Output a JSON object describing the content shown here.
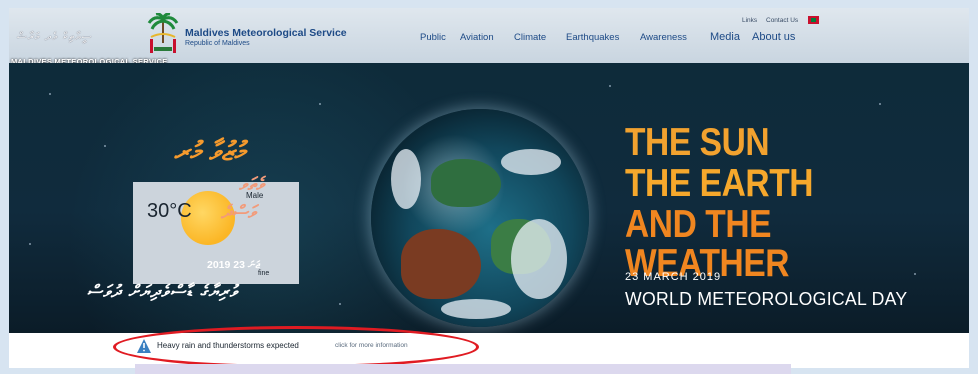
{
  "header": {
    "logo_dhivehi_text": "ސީޔާތިކް ވެދ މަރާޝް",
    "site_name": "Maldives Meteorological Service",
    "site_subtitle": "Republic of Maldives",
    "brand_strip": "MALDIVES METEOROLOGICAL SERVICE",
    "util_links": [
      "Links",
      "Contact Us"
    ],
    "nav": [
      "Public",
      "Aviation",
      "Climate",
      "Earthquakes",
      "Awareness",
      "Media",
      "About us"
    ]
  },
  "weather_widget": {
    "temperature": "30°C",
    "city": "Male",
    "condition": "fine",
    "dhivehi_heading": "މުޒުވާ މުރ",
    "dhivehi_condition_1": "ވެތަވ",
    "dhivehi_condition_2": "ވަސްދެ",
    "date_line": "2019 ޖަނަ 23",
    "dhivehi_event": "ވުރިޔާގެ ޑާސްވެދިޔަށް ދުވަސް"
  },
  "banner": {
    "headline": [
      "THE SUN",
      "THE EARTH",
      "AND THE WEATHER"
    ],
    "event_date": "23 MARCH 2019",
    "event_name": "WORLD METEOROLOGICAL DAY"
  },
  "alert": {
    "title": "Heavy rain and thunderstorms expected",
    "more_link": "click for more information"
  },
  "colors": {
    "nav_text": "#1d4a86",
    "headline_orange": "#f2a22f",
    "highlight_red": "#e01b22"
  }
}
